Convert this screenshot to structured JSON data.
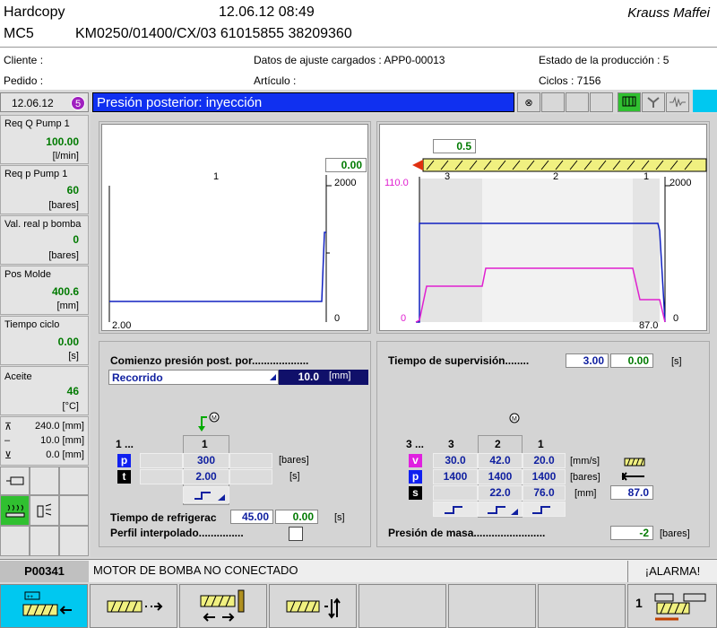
{
  "header": {
    "title": "Hardcopy",
    "datetime": "12.06.12 08:49",
    "brand": "Krauss Maffei",
    "machine": "MC5",
    "code": "KM0250/01400/CX/03 61015855 38209360"
  },
  "info": {
    "cliente": "Cliente :",
    "pedido": "Pedido :",
    "datos": "Datos de ajuste cargados : APP0-00013",
    "articulo": "Artículo :",
    "estado": "Estado de la producción : 5",
    "ciclos": "Ciclos : 7156"
  },
  "topbar": {
    "date": "12.06.12",
    "badge": "5",
    "screen_title": "Presión posterior: inyección"
  },
  "sidebar": [
    {
      "label": "Req Q Pump 1",
      "value": "100.00",
      "unit": "[l/min]"
    },
    {
      "label": "Req p Pump 1",
      "value": "60",
      "unit": "[bares]"
    },
    {
      "label": "Val. real p bomba",
      "value": "0",
      "unit": "[bares]"
    },
    {
      "label": "Pos Molde",
      "value": "400.6",
      "unit": "[mm]"
    },
    {
      "label": "Tiempo ciclo",
      "value": "0.00",
      "unit": "[s]"
    },
    {
      "label": "Aceite",
      "value": "46",
      "unit": "[°C]"
    }
  ],
  "positions": [
    {
      "value": "240.0 [mm]"
    },
    {
      "value": "10.0 [mm]"
    },
    {
      "value": "0.0 [mm]"
    }
  ],
  "left_chart": {
    "value_box": "0.00",
    "stage": "1",
    "y_right_max": "2000",
    "y_right_min": "0",
    "x_left": "2.00"
  },
  "right_chart": {
    "screw_pos": "0.5",
    "stage3": "3",
    "stage2": "2",
    "stage1": "1",
    "y_left_max": "110.0",
    "y_left_min": "0",
    "y_right_max": "2000",
    "y_right_min": "0",
    "x_right": "87.0"
  },
  "holding": {
    "title": "Comienzo presión post. por...................",
    "mode": "Recorrido",
    "mode_value": "10.0",
    "mode_unit": "[mm]",
    "col_prefix": "1 ...",
    "col1": "1",
    "p_label": "p",
    "t_label": "t",
    "p_value": "300",
    "t_value": "2.00",
    "p_unit": "[bares]",
    "t_unit": "[s]",
    "cooling_label": "Tiempo de refrigerac",
    "cooling_set": "45.00",
    "cooling_act": "0.00",
    "cooling_unit": "[s]",
    "profile_label": "Perfil interpolado..............."
  },
  "injection": {
    "supervision_label": "Tiempo de supervisión........",
    "supervision_set": "3.00",
    "supervision_act": "0.00",
    "supervision_unit": "[s]",
    "col_prefix": "3 ...",
    "cols": [
      "3",
      "2",
      "1"
    ],
    "v_label": "v",
    "p_label": "p",
    "s_label": "s",
    "v_values": [
      "30.0",
      "42.0",
      "20.0"
    ],
    "p_values": [
      "1400",
      "1400",
      "1400"
    ],
    "s_values": [
      "",
      "22.0",
      "76.0"
    ],
    "v_unit": "[mm/s]",
    "p_unit": "[bares]",
    "s_unit": "[mm]",
    "s_total": "87.0",
    "mass_label": "Presión de masa........................",
    "mass_value": "-2",
    "mass_unit": "[bares]"
  },
  "status": {
    "code": "P00341",
    "message": "MOTOR DE BOMBA NO CONECTADO",
    "alarm": "¡ALARMA!"
  },
  "footer": {
    "last_num": "1"
  }
}
